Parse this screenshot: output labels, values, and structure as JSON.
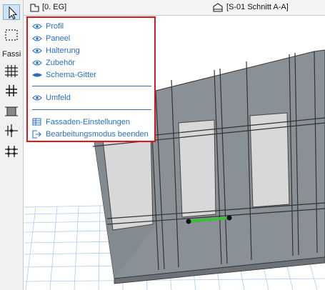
{
  "toolbox": {
    "section_label": "Fassi",
    "tools": [
      {
        "icon": "arrow-pointer-icon"
      },
      {
        "icon": "marquee-icon"
      },
      {
        "icon": "curtain-wall-grid-icon"
      },
      {
        "icon": "frame-icon"
      },
      {
        "icon": "panel-icon"
      },
      {
        "icon": "junction-icon"
      },
      {
        "icon": "accessory-icon"
      }
    ]
  },
  "topbar": {
    "story_label": "[0. EG]",
    "section_view_label": "[S-01 Schnitt A-A]"
  },
  "context_menu": {
    "group1": [
      {
        "label": "Profil",
        "icon": "eye-icon"
      },
      {
        "label": "Paneel",
        "icon": "eye-icon"
      },
      {
        "label": "Halterung",
        "icon": "eye-icon"
      },
      {
        "label": "Zubehör",
        "icon": "eye-icon"
      },
      {
        "label": "Schema-Gitter",
        "icon": "eye-closed-icon"
      }
    ],
    "group2": [
      {
        "label": "Umfeld",
        "icon": "eye-icon"
      }
    ],
    "group3": [
      {
        "label": "Fassaden-Einstellungen",
        "icon": "table-settings-icon"
      },
      {
        "label": "Bearbeitungsmodus beenden",
        "icon": "exit-icon"
      }
    ]
  },
  "colors": {
    "menu_border": "#e4141c",
    "menu_text": "#2a6fc0",
    "grid_lines": "#9fc4ea",
    "selected_frame": "#3bbf3b"
  }
}
